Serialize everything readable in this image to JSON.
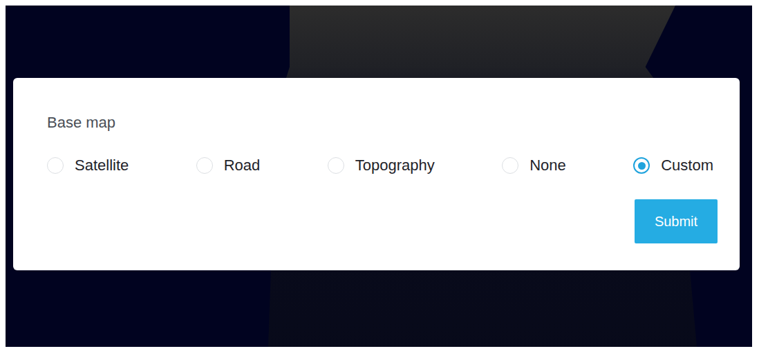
{
  "form": {
    "label": "Base map",
    "options": [
      {
        "label": "Satellite",
        "selected": false
      },
      {
        "label": "Road",
        "selected": false
      },
      {
        "label": "Topography",
        "selected": false
      },
      {
        "label": "None",
        "selected": false
      },
      {
        "label": "Custom",
        "selected": true
      }
    ],
    "buttons": [
      "Submit"
    ]
  }
}
